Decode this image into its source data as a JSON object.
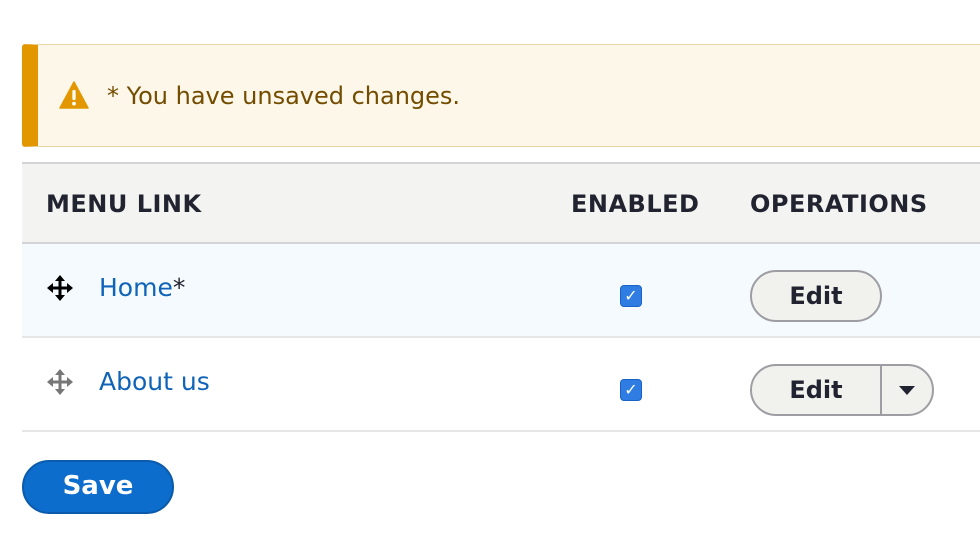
{
  "warning": {
    "message": "* You have unsaved changes.",
    "icon": "warning-triangle-icon",
    "accent_color": "#e29700"
  },
  "table": {
    "headers": {
      "menu_link": "MENU LINK",
      "enabled": "ENABLED",
      "operations": "OPERATIONS"
    },
    "rows": [
      {
        "title": "Home",
        "changed_marker": "*",
        "enabled": true,
        "edit_label": "Edit",
        "highlighted": true
      },
      {
        "title": "About us",
        "changed_marker": "",
        "enabled": true,
        "edit_label": "Edit",
        "highlighted": false
      }
    ],
    "checkmark": "✓"
  },
  "actions": {
    "save_label": "Save",
    "primary_color": "#0c6dcc"
  }
}
